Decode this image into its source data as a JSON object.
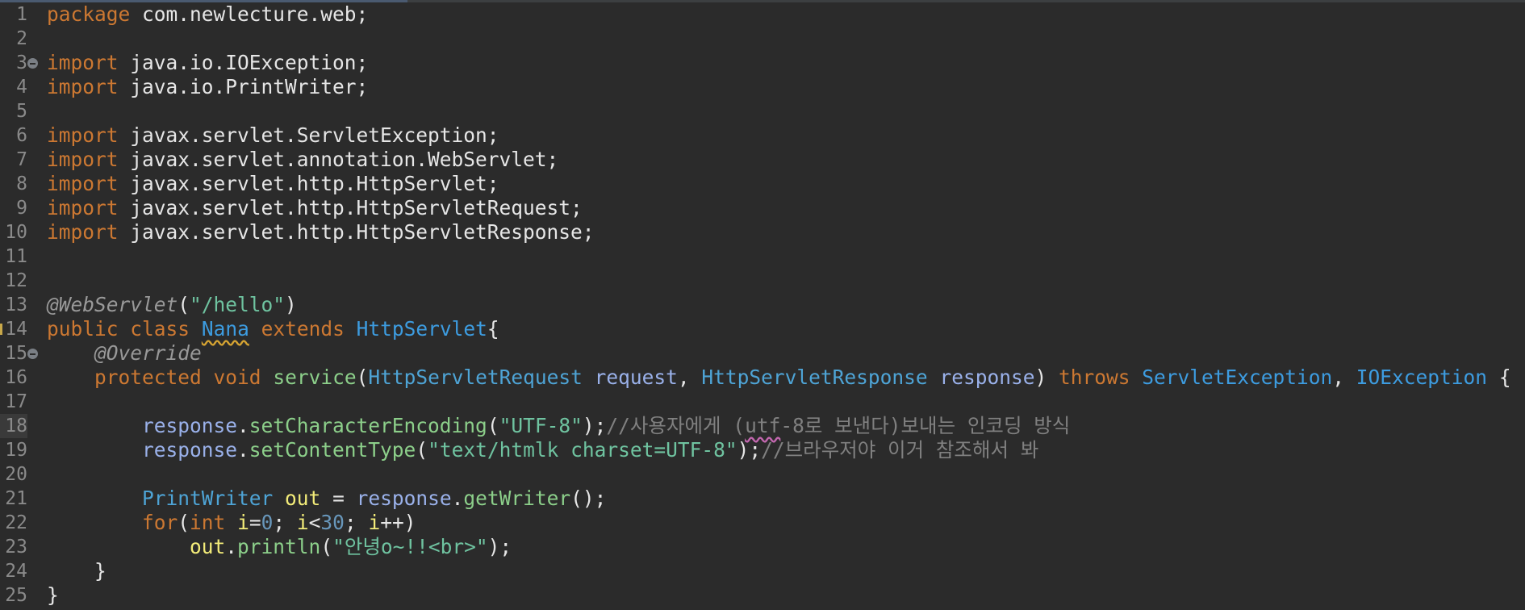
{
  "editor": {
    "lines": [
      {
        "n": "1",
        "tokens": [
          {
            "t": "package",
            "c": "kw"
          },
          {
            "t": " com.newlecture.web;",
            "c": "plain"
          }
        ]
      },
      {
        "n": "2",
        "tokens": []
      },
      {
        "n": "3",
        "fold": true,
        "tokens": [
          {
            "t": "import",
            "c": "kw"
          },
          {
            "t": " java.io.IOException;",
            "c": "plain"
          }
        ]
      },
      {
        "n": "4",
        "tokens": [
          {
            "t": "import",
            "c": "kw"
          },
          {
            "t": " java.io.PrintWriter;",
            "c": "plain"
          }
        ]
      },
      {
        "n": "5",
        "tokens": []
      },
      {
        "n": "6",
        "tokens": [
          {
            "t": "import",
            "c": "kw"
          },
          {
            "t": " javax.servlet.ServletException;",
            "c": "plain"
          }
        ]
      },
      {
        "n": "7",
        "tokens": [
          {
            "t": "import",
            "c": "kw"
          },
          {
            "t": " javax.servlet.annotation.WebServlet;",
            "c": "plain"
          }
        ]
      },
      {
        "n": "8",
        "tokens": [
          {
            "t": "import",
            "c": "kw"
          },
          {
            "t": " javax.servlet.http.HttpServlet;",
            "c": "plain"
          }
        ]
      },
      {
        "n": "9",
        "tokens": [
          {
            "t": "import",
            "c": "kw"
          },
          {
            "t": " javax.servlet.http.HttpServletRequest;",
            "c": "plain"
          }
        ]
      },
      {
        "n": "10",
        "tokens": [
          {
            "t": "import",
            "c": "kw"
          },
          {
            "t": " javax.servlet.http.HttpServletResponse;",
            "c": "plain"
          }
        ]
      },
      {
        "n": "11",
        "tokens": []
      },
      {
        "n": "12",
        "tokens": []
      },
      {
        "n": "13",
        "tokens": [
          {
            "t": "@WebServlet",
            "c": "ann"
          },
          {
            "t": "(",
            "c": "plain"
          },
          {
            "t": "\"/hello\"",
            "c": "str"
          },
          {
            "t": ")",
            "c": "plain"
          }
        ]
      },
      {
        "n": "14",
        "warn": true,
        "tokens": [
          {
            "t": "public",
            "c": "kw"
          },
          {
            "t": " ",
            "c": "plain"
          },
          {
            "t": "class",
            "c": "kw"
          },
          {
            "t": " ",
            "c": "plain"
          },
          {
            "t": "Nana",
            "c": "cls squig-warn"
          },
          {
            "t": " ",
            "c": "plain"
          },
          {
            "t": "extends",
            "c": "kw"
          },
          {
            "t": " ",
            "c": "plain"
          },
          {
            "t": "HttpServlet",
            "c": "cls"
          },
          {
            "t": "{",
            "c": "plain"
          }
        ]
      },
      {
        "n": "15",
        "fold": true,
        "tokens": [
          {
            "t": "    ",
            "c": "plain"
          },
          {
            "t": "@Override",
            "c": "ann"
          }
        ]
      },
      {
        "n": "16",
        "tokens": [
          {
            "t": "    ",
            "c": "plain"
          },
          {
            "t": "protected",
            "c": "kw"
          },
          {
            "t": " ",
            "c": "plain"
          },
          {
            "t": "void",
            "c": "kw"
          },
          {
            "t": " ",
            "c": "plain"
          },
          {
            "t": "service",
            "c": "method"
          },
          {
            "t": "(",
            "c": "plain"
          },
          {
            "t": "HttpServletRequest",
            "c": "type"
          },
          {
            "t": " ",
            "c": "plain"
          },
          {
            "t": "request",
            "c": "var"
          },
          {
            "t": ", ",
            "c": "plain"
          },
          {
            "t": "HttpServletResponse",
            "c": "type"
          },
          {
            "t": " ",
            "c": "plain"
          },
          {
            "t": "response",
            "c": "var"
          },
          {
            "t": ") ",
            "c": "plain"
          },
          {
            "t": "throws",
            "c": "kw"
          },
          {
            "t": " ",
            "c": "plain"
          },
          {
            "t": "ServletException",
            "c": "cls"
          },
          {
            "t": ", ",
            "c": "plain"
          },
          {
            "t": "IOException",
            "c": "cls"
          },
          {
            "t": " {",
            "c": "plain"
          }
        ]
      },
      {
        "n": "17",
        "tokens": []
      },
      {
        "n": "18",
        "current": true,
        "tokens": [
          {
            "t": "        ",
            "c": "plain"
          },
          {
            "t": "response",
            "c": "var"
          },
          {
            "t": ".",
            "c": "plain"
          },
          {
            "t": "setCharacterEncoding",
            "c": "method"
          },
          {
            "t": "(",
            "c": "plain"
          },
          {
            "t": "\"UTF-8\"",
            "c": "str"
          },
          {
            "t": ");",
            "c": "plain"
          },
          {
            "t": "//사용자에게 (",
            "c": "cmt"
          },
          {
            "t": "utf",
            "c": "cmt squig-spell"
          },
          {
            "t": "-8로 보낸다)보내는 인코딩 방식",
            "c": "cmt"
          }
        ]
      },
      {
        "n": "19",
        "tokens": [
          {
            "t": "        ",
            "c": "plain"
          },
          {
            "t": "response",
            "c": "var"
          },
          {
            "t": ".",
            "c": "plain"
          },
          {
            "t": "setContentType",
            "c": "method"
          },
          {
            "t": "(",
            "c": "plain"
          },
          {
            "t": "\"text/htmlk charset=UTF-8\"",
            "c": "str"
          },
          {
            "t": ");",
            "c": "plain"
          },
          {
            "t": "//브라우저야 이거 참조해서 봐",
            "c": "cmt"
          }
        ]
      },
      {
        "n": "20",
        "tokens": []
      },
      {
        "n": "21",
        "tokens": [
          {
            "t": "        ",
            "c": "plain"
          },
          {
            "t": "PrintWriter",
            "c": "type"
          },
          {
            "t": " ",
            "c": "plain"
          },
          {
            "t": "out",
            "c": "loc"
          },
          {
            "t": " = ",
            "c": "plain"
          },
          {
            "t": "response",
            "c": "var"
          },
          {
            "t": ".",
            "c": "plain"
          },
          {
            "t": "getWriter",
            "c": "method"
          },
          {
            "t": "();",
            "c": "plain"
          }
        ]
      },
      {
        "n": "22",
        "tokens": [
          {
            "t": "        ",
            "c": "plain"
          },
          {
            "t": "for",
            "c": "kw"
          },
          {
            "t": "(",
            "c": "plain"
          },
          {
            "t": "int",
            "c": "kw"
          },
          {
            "t": " ",
            "c": "plain"
          },
          {
            "t": "i",
            "c": "loc"
          },
          {
            "t": "=",
            "c": "plain"
          },
          {
            "t": "0",
            "c": "num"
          },
          {
            "t": "; ",
            "c": "plain"
          },
          {
            "t": "i",
            "c": "loc"
          },
          {
            "t": "<",
            "c": "plain"
          },
          {
            "t": "30",
            "c": "num"
          },
          {
            "t": "; ",
            "c": "plain"
          },
          {
            "t": "i",
            "c": "loc"
          },
          {
            "t": "++)",
            "c": "plain"
          }
        ]
      },
      {
        "n": "23",
        "tokens": [
          {
            "t": "            ",
            "c": "plain"
          },
          {
            "t": "out",
            "c": "loc"
          },
          {
            "t": ".",
            "c": "plain"
          },
          {
            "t": "println",
            "c": "method"
          },
          {
            "t": "(",
            "c": "plain"
          },
          {
            "t": "\"안녕o~!!<br>\"",
            "c": "str"
          },
          {
            "t": ");",
            "c": "plain"
          }
        ]
      },
      {
        "n": "24",
        "tokens": [
          {
            "t": "    }",
            "c": "plain"
          }
        ]
      },
      {
        "n": "25",
        "tokens": [
          {
            "t": "}",
            "c": "plain"
          }
        ]
      }
    ]
  }
}
